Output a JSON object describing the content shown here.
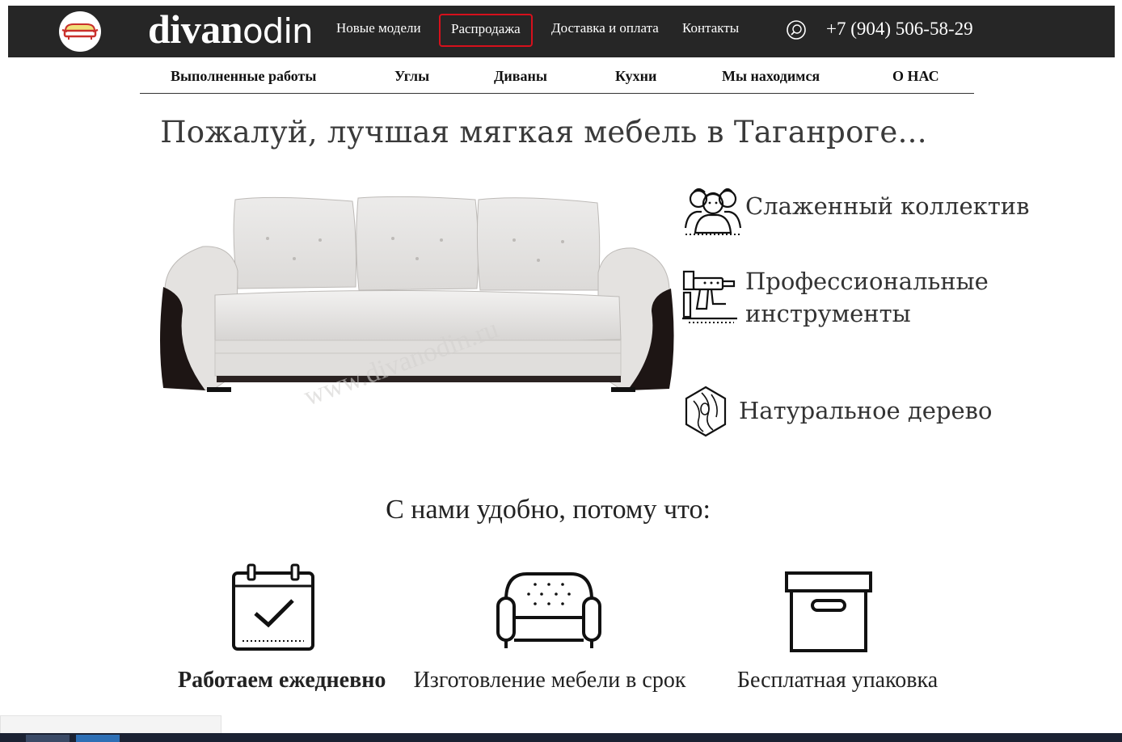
{
  "header": {
    "brand_bold": "divan",
    "brand_light": "odin",
    "nav": [
      {
        "label": "Новые модели"
      },
      {
        "label": "Распродажа"
      },
      {
        "label": "Доставка и оплата"
      },
      {
        "label": "Контакты"
      }
    ],
    "phone": "+7 (904) 506-58-29",
    "sale_border_color": "#d6101c",
    "bg_color": "#262626"
  },
  "subnav": [
    {
      "label": "Выполненные работы"
    },
    {
      "label": "Углы"
    },
    {
      "label": "Диваны"
    },
    {
      "label": "Кухни"
    },
    {
      "label": "Мы находимся"
    },
    {
      "label": "О НАС"
    }
  ],
  "hero": {
    "headline": "Пожалуй, лучшая мягкая мебель в Таганроге...",
    "watermark": "www.divanodin.ru",
    "features": [
      {
        "icon": "team-icon",
        "text": "Слаженный коллектив"
      },
      {
        "icon": "tool-icon",
        "line1": "Профессиональные",
        "line2": "инструменты"
      },
      {
        "icon": "wood-icon",
        "text": "Натуральное дерево"
      }
    ]
  },
  "benefits": {
    "heading": "С нами удобно, потому что:",
    "items": [
      {
        "icon": "calendar-check-icon",
        "label": "Работаем ежедневно"
      },
      {
        "icon": "armchair-icon",
        "label": "Изготовление мебели в срок"
      },
      {
        "icon": "box-icon",
        "label": "Бесплатная упаковка"
      }
    ]
  }
}
